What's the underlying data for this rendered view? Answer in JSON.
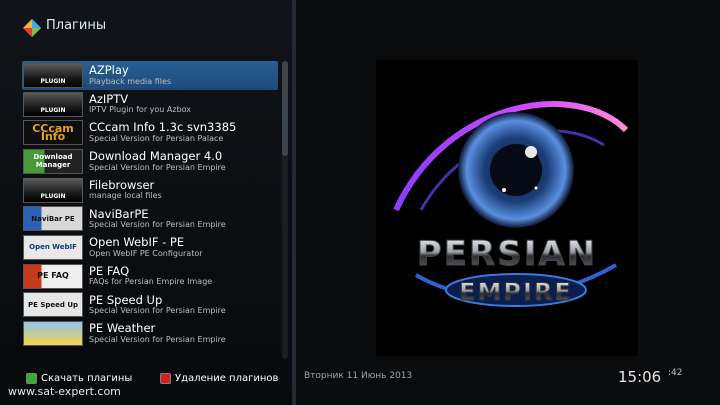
{
  "header": {
    "title": "Плагины",
    "logo_icon": "enigma-logo-icon"
  },
  "plugins": [
    {
      "name": "AZPlay",
      "desc": "Playback media files",
      "thumb": "PLUGIN",
      "thumb_style": "plugin",
      "selected": true
    },
    {
      "name": "AzIPTV",
      "desc": "IPTV Plugin for you Azbox",
      "thumb": "PLUGIN",
      "thumb_style": "plugin",
      "selected": false
    },
    {
      "name": "CCcam Info 1.3c svn3385",
      "desc": "Special Version for Persian Palace",
      "thumb": "CCcam Info",
      "thumb_style": "cccam",
      "selected": false
    },
    {
      "name": "Download Manager 4.0",
      "desc": "Special Version for Persian Empire",
      "thumb": "Download Manager",
      "thumb_style": "download",
      "selected": false
    },
    {
      "name": "Filebrowser",
      "desc": "manage local files",
      "thumb": "PLUGIN",
      "thumb_style": "plugin",
      "selected": false
    },
    {
      "name": "NaviBarPE",
      "desc": "Special Version for Persian Empire",
      "thumb": "NaviBar PE",
      "thumb_style": "navibar",
      "selected": false
    },
    {
      "name": "Open WebIF - PE",
      "desc": "Open WebIF PE Configurator",
      "thumb": "Open WebIF",
      "thumb_style": "openwebif",
      "selected": false
    },
    {
      "name": "PE FAQ",
      "desc": "FAQs for Persian Empire Image",
      "thumb": "PE FAQ",
      "thumb_style": "faq",
      "selected": false
    },
    {
      "name": "PE Speed Up",
      "desc": "Special Version for Persian Empire",
      "thumb": "PE Speed Up",
      "thumb_style": "speed",
      "selected": false
    },
    {
      "name": "PE Weather",
      "desc": "Special Version for Persian Empire",
      "thumb": "",
      "thumb_style": "weather",
      "selected": false
    }
  ],
  "footer": {
    "green_label": "Скачать плагины",
    "red_label": "Удаление плагинов",
    "green_color": "#2fb02f",
    "red_color": "#d22121"
  },
  "watermark": "www.sat-expert.com",
  "preview": {
    "line1": "PERSIAN",
    "line2": "EMPIRE"
  },
  "status": {
    "date": "Вторник 11 Июнь 2013",
    "time": "15:06",
    "seconds": ":42"
  }
}
